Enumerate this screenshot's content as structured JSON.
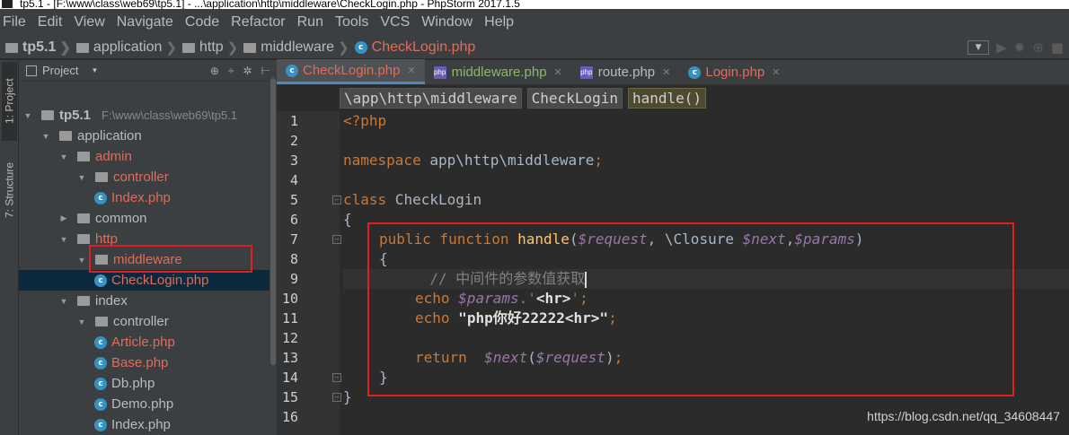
{
  "window": {
    "title": "tp5.1 - [F:\\www\\class\\web69\\tp5.1] - ...\\application\\http\\middleware\\CheckLogin.php - PhpStorm 2017.1.5"
  },
  "menu": [
    "File",
    "Edit",
    "View",
    "Navigate",
    "Code",
    "Refactor",
    "Run",
    "Tools",
    "VCS",
    "Window",
    "Help"
  ],
  "breadcrumbs": {
    "items": [
      "tp5.1",
      "application",
      "http",
      "middleware"
    ],
    "file": "CheckLogin.php"
  },
  "sidebar": {
    "project_tab": "1: Project",
    "structure_tab": "7: Structure"
  },
  "project_panel": {
    "title": "Project",
    "tree": [
      {
        "label": "tp5.1",
        "path": "F:\\www\\class\\web69\\tp5.1",
        "type": "folder",
        "expanded": true,
        "level": 0,
        "color": "plain"
      },
      {
        "label": "application",
        "type": "folder",
        "expanded": true,
        "level": 1,
        "color": "plain"
      },
      {
        "label": "admin",
        "type": "folder",
        "expanded": true,
        "level": 2,
        "color": "red"
      },
      {
        "label": "controller",
        "type": "folder",
        "expanded": true,
        "level": 3,
        "color": "red"
      },
      {
        "label": "Index.php",
        "type": "file",
        "level": 4,
        "color": "red"
      },
      {
        "label": "common",
        "type": "folder",
        "expanded": false,
        "level": 2,
        "color": "plain"
      },
      {
        "label": "http",
        "type": "folder",
        "expanded": true,
        "level": 2,
        "color": "red"
      },
      {
        "label": "middleware",
        "type": "folder",
        "expanded": true,
        "level": 3,
        "color": "red"
      },
      {
        "label": "CheckLogin.php",
        "type": "file",
        "level": 4,
        "color": "red",
        "selected": true
      },
      {
        "label": "index",
        "type": "folder",
        "expanded": true,
        "level": 2,
        "color": "plain"
      },
      {
        "label": "controller",
        "type": "folder",
        "expanded": true,
        "level": 3,
        "color": "plain"
      },
      {
        "label": "Article.php",
        "type": "file",
        "level": 4,
        "color": "red"
      },
      {
        "label": "Base.php",
        "type": "file",
        "level": 4,
        "color": "red"
      },
      {
        "label": "Db.php",
        "type": "file",
        "level": 4,
        "color": "plain"
      },
      {
        "label": "Demo.php",
        "type": "file",
        "level": 4,
        "color": "plain"
      },
      {
        "label": "Index.php",
        "type": "file",
        "level": 4,
        "color": "plain"
      },
      {
        "label": "Login.php",
        "type": "file",
        "level": 4,
        "color": "red"
      }
    ]
  },
  "editor": {
    "tabs": [
      {
        "label": "CheckLogin.php",
        "active": true,
        "color": "red",
        "icon": "class-icon"
      },
      {
        "label": "middleware.php",
        "active": false,
        "color": "green",
        "icon": "php-file-icon"
      },
      {
        "label": "route.php",
        "active": false,
        "color": "plain",
        "icon": "php-file-icon"
      },
      {
        "label": "Login.php",
        "active": false,
        "color": "red",
        "icon": "class-icon"
      }
    ],
    "code_breadcrumbs": [
      "\\app\\http\\middleware",
      "CheckLogin",
      "handle()"
    ],
    "line_numbers": [
      "1",
      "2",
      "3",
      "4",
      "5",
      "6",
      "7",
      "8",
      "9",
      "10",
      "11",
      "12",
      "13",
      "14",
      "15",
      "16"
    ],
    "lines": {
      "l1": "<?php",
      "l3_kw": "namespace",
      "l3_rest": " app\\http\\middleware",
      "l3_semi": ";",
      "l5_kw": "class",
      "l5_rest": " CheckLogin",
      "l6": "{",
      "l7_kw": "public function",
      "l7_fn": "handle",
      "l7_p1": "(",
      "l7_v1": "$request",
      "l7_p2": ", \\Closure ",
      "l7_v2": "$next",
      "l7_p3": ",",
      "l7_v3": "$params",
      "l7_p4": ")",
      "l8": "{",
      "l9": "// 中间件的参数值获取",
      "l10_kw": "echo",
      "l10_var": "$params",
      "l10_dot": ".",
      "l10_q1": "'",
      "l10_tag": "<hr>",
      "l10_q2": "'",
      "l10_semi": ";",
      "l11_kw": "echo",
      "l11_q1": "\"",
      "l11_text": "php你好22222",
      "l11_tag": "<hr>",
      "l11_q2": "\"",
      "l11_semi": ";",
      "l13_kw": "return",
      "l13_var": "$next",
      "l13_p1": "(",
      "l13_arg": "$request",
      "l13_p2": ")",
      "l13_semi": ";",
      "l14": "}",
      "l15": "}"
    }
  },
  "watermark": "https://blog.csdn.net/qq_34608447"
}
